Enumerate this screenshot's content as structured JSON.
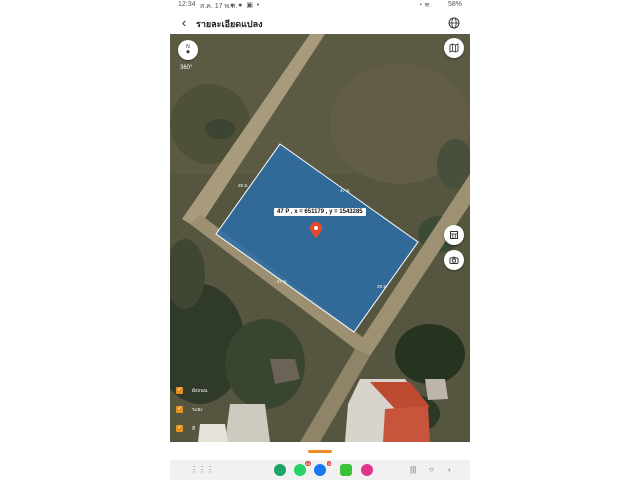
{
  "status": {
    "time": "12:34",
    "date": "ส.ค. 17 พ.ส.",
    "battery": "58%"
  },
  "header": {
    "title": "รายละเอียดแปลง",
    "back_icon": "arrow-left-icon",
    "globe_icon": "globe-icon"
  },
  "map": {
    "compass_label": "N",
    "heading": "360°",
    "map_type_icon": "map-icon",
    "layers_icon": "layers-icon",
    "camera_icon": "camera-icon",
    "marker_label": "47 P , x = 651179 , y = 1543285",
    "parcel_color": "#2a6ea8",
    "edge_labels": {
      "north_west": "29 ม.",
      "north_east": "47 ม.",
      "south_west": "47 ม.",
      "south_east": "29 ม."
    }
  },
  "legend": [
    {
      "label": "ผังถนน",
      "checked": true
    },
    {
      "label": "ระยะ",
      "checked": true
    },
    {
      "label": "สี",
      "checked": true
    }
  ],
  "navbar": {
    "apps": [
      {
        "name": "phone-app-icon",
        "color": "#1fa56a"
      },
      {
        "name": "whatsapp-app-icon",
        "color": "#25d366",
        "badge": "16"
      },
      {
        "name": "messenger-app-icon",
        "color": "#1877f2",
        "badge": "3"
      },
      {
        "name": "line-app-icon",
        "color": "#3ac13a"
      },
      {
        "name": "flower-app-icon",
        "color": "#e0358d"
      }
    ],
    "recent_icon": "recent-apps-icon",
    "home_icon": "home-icon",
    "back_icon": "back-nav-icon"
  }
}
